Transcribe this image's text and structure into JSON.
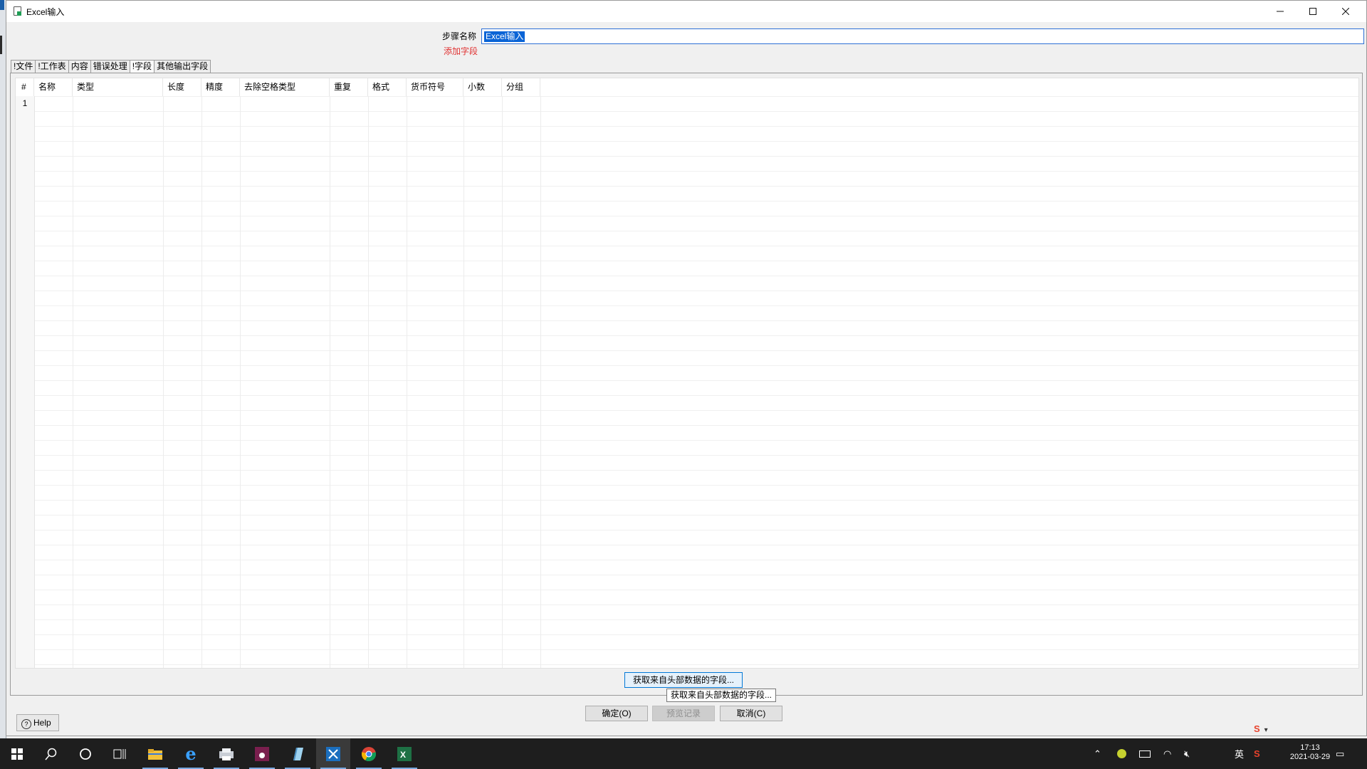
{
  "window": {
    "title": "Excel输入"
  },
  "step": {
    "label": "步骤名称",
    "value": "Excel输入",
    "add_field_link": "添加字段"
  },
  "tabs": [
    {
      "label": "!文件"
    },
    {
      "label": "!工作表"
    },
    {
      "label": "内容"
    },
    {
      "label": "错误处理"
    },
    {
      "label": "!字段",
      "active": true
    },
    {
      "label": "其他输出字段"
    }
  ],
  "grid": {
    "row_header": "#",
    "columns": [
      "名称",
      "类型",
      "长度",
      "精度",
      "去除空格类型",
      "重复",
      "格式",
      "货币符号",
      "小数",
      "分组"
    ],
    "rows": [
      [
        "1"
      ]
    ]
  },
  "buttons": {
    "get_fields": "获取来自头部数据的字段...",
    "tooltip": "获取来自头部数据的字段...",
    "ok": "确定(O)",
    "preview": "预览记录",
    "cancel": "取消(C)",
    "help": "Help"
  },
  "taskbar": {
    "apps": [
      "windows-start",
      "search",
      "cortana",
      "task-view",
      "file-explorer",
      "internet-explorer",
      "app-spoon",
      "app-pink",
      "app-notepad",
      "app-kettle",
      "chrome",
      "excel"
    ],
    "ime": "英",
    "time": "17:13",
    "date": "2021-03-29"
  },
  "colors": {
    "accent": "#0078d7",
    "add_field": "#e03030",
    "selection": "#0a64d6",
    "taskbar": "#1e1e1e"
  }
}
